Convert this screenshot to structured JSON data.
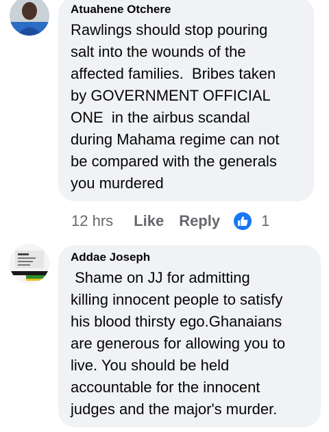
{
  "comments": [
    {
      "author": "Atuahene Otchere",
      "text": "Rawlings should stop pouring\nsalt into the wounds of the\naffected families.  Bribes taken\nby GOVERNMENT OFFICIAL\nONE  in the airbus scandal\nduring Mahama regime can not\nbe compared with the generals\nyou murdered",
      "time": "12 hrs",
      "like_label": "Like",
      "reply_label": "Reply",
      "reaction_icon": "like-icon",
      "reaction_count": "1"
    },
    {
      "author": "Addae Joseph",
      "text": " Shame on JJ for admitting\nkilling innocent people to satisfy\nhis blood thirsty ego.Ghanaians\nare generous for allowing you to\nlive. You should be held\naccountable for the innocent\njudges and the major's murder."
    }
  ],
  "colors": {
    "bubble_bg": "#f0f2f5",
    "meta_text": "#65676b",
    "like_blue": "#1877f2"
  }
}
